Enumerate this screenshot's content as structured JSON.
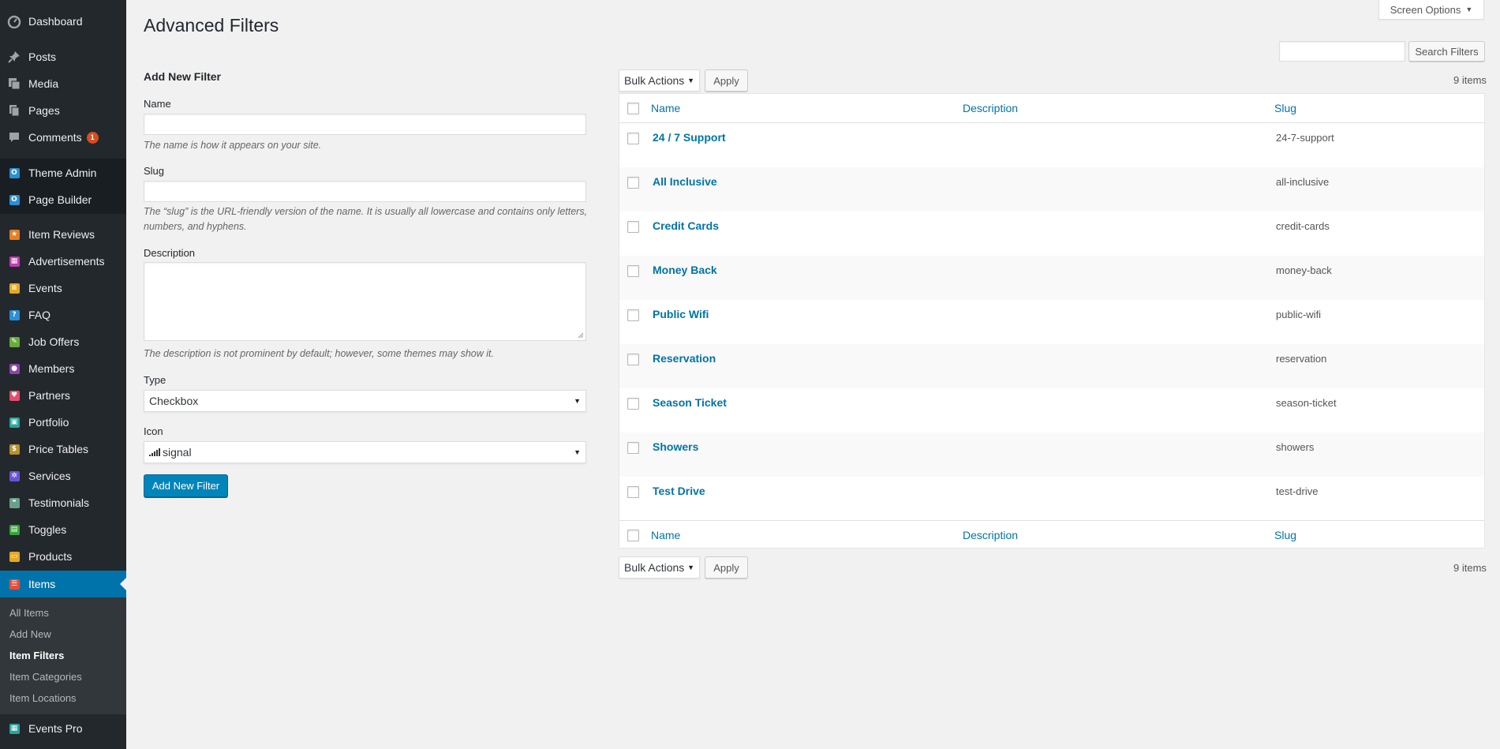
{
  "sidebar": {
    "items": [
      {
        "label": "Dashboard",
        "icon": "dashboard-icon"
      },
      {
        "label": "Posts",
        "icon": "pin-icon"
      },
      {
        "label": "Media",
        "icon": "media-icon"
      },
      {
        "label": "Pages",
        "icon": "pages-icon"
      },
      {
        "label": "Comments",
        "icon": "comments-icon",
        "badge": "1"
      },
      {
        "label": "Theme Admin",
        "icon": "theme-admin-icon"
      },
      {
        "label": "Page Builder",
        "icon": "page-builder-icon"
      },
      {
        "label": "Item Reviews",
        "icon": "star-icon"
      },
      {
        "label": "Advertisements",
        "icon": "advertisements-icon"
      },
      {
        "label": "Events",
        "icon": "events-icon"
      },
      {
        "label": "FAQ",
        "icon": "faq-icon"
      },
      {
        "label": "Job Offers",
        "icon": "job-offers-icon"
      },
      {
        "label": "Members",
        "icon": "members-icon"
      },
      {
        "label": "Partners",
        "icon": "heart-icon"
      },
      {
        "label": "Portfolio",
        "icon": "portfolio-icon"
      },
      {
        "label": "Price Tables",
        "icon": "dollar-icon"
      },
      {
        "label": "Services",
        "icon": "gear-icon"
      },
      {
        "label": "Testimonials",
        "icon": "testimonials-icon"
      },
      {
        "label": "Toggles",
        "icon": "toggles-icon"
      },
      {
        "label": "Products",
        "icon": "products-icon"
      },
      {
        "label": "Items",
        "icon": "items-list-icon"
      },
      {
        "label": "Events Pro",
        "icon": "events-pro-icon"
      }
    ],
    "submenu": [
      "All Items",
      "Add New",
      "Item Filters",
      "Item Categories",
      "Item Locations"
    ],
    "icon_colors": {
      "star-icon": "#e67e22",
      "advertisements-icon": "#c43bb0",
      "events-icon": "#e5a823",
      "faq-icon": "#2a8fd6",
      "job-offers-icon": "#6aab3a",
      "members-icon": "#8e44ad",
      "heart-icon": "#e74c6c",
      "portfolio-icon": "#2aa59b",
      "dollar-icon": "#b8932b",
      "gear-icon": "#6a55d8",
      "testimonials-icon": "#6aa08a",
      "toggles-icon": "#3aa43a",
      "products-icon": "#e5a823",
      "items-list-icon": "#e74c3c",
      "events-pro-icon": "#2aa59b"
    }
  },
  "header": {
    "title": "Advanced Filters",
    "screen_options": "Screen Options",
    "search_button": "Search Filters"
  },
  "form": {
    "heading": "Add New Filter",
    "name_label": "Name",
    "name_hint": "The name is how it appears on your site.",
    "slug_label": "Slug",
    "slug_hint": "The “slug” is the URL-friendly version of the name. It is usually all lowercase and contains only letters, numbers, and hyphens.",
    "description_label": "Description",
    "description_hint": "The description is not prominent by default; however, some themes may show it.",
    "type_label": "Type",
    "type_value": "Checkbox",
    "icon_label": "Icon",
    "icon_value": "signal",
    "submit_label": "Add New Filter"
  },
  "table": {
    "bulk_actions": "Bulk Actions",
    "apply": "Apply",
    "count": "9 items",
    "columns": [
      "Name",
      "Description",
      "Slug"
    ],
    "rows": [
      {
        "name": "24 / 7 Support",
        "slug": "24-7-support"
      },
      {
        "name": "All Inclusive",
        "slug": "all-inclusive"
      },
      {
        "name": "Credit Cards",
        "slug": "credit-cards"
      },
      {
        "name": "Money Back",
        "slug": "money-back"
      },
      {
        "name": "Public Wifi",
        "slug": "public-wifi"
      },
      {
        "name": "Reservation",
        "slug": "reservation"
      },
      {
        "name": "Season Ticket",
        "slug": "season-ticket"
      },
      {
        "name": "Showers",
        "slug": "showers"
      },
      {
        "name": "Test Drive",
        "slug": "test-drive"
      }
    ]
  }
}
